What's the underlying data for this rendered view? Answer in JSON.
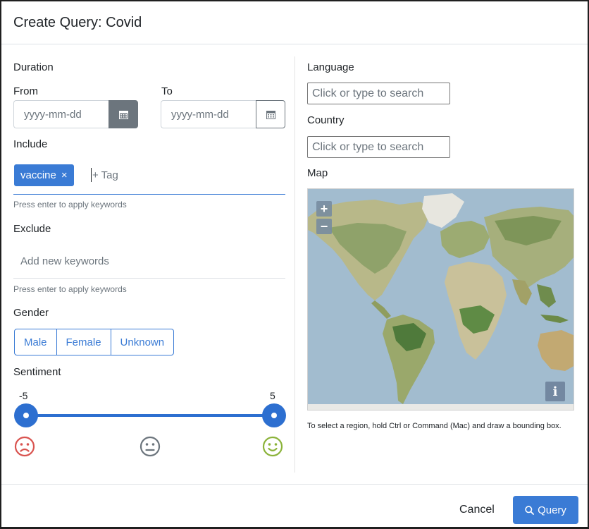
{
  "modal": {
    "title": "Create Query: Covid"
  },
  "duration": {
    "label": "Duration",
    "from_label": "From",
    "to_label": "To",
    "from_placeholder": "yyyy-mm-dd",
    "to_placeholder": "yyyy-mm-dd"
  },
  "include": {
    "label": "Include",
    "tags": [
      {
        "text": "vaccine",
        "remove": "×"
      }
    ],
    "tag_placeholder": "+ Tag",
    "help": "Press enter to apply keywords"
  },
  "exclude": {
    "label": "Exclude",
    "placeholder": "Add new keywords",
    "help": "Press enter to apply keywords"
  },
  "gender": {
    "label": "Gender",
    "options": [
      "Male",
      "Female",
      "Unknown"
    ]
  },
  "sentiment": {
    "label": "Sentiment",
    "min": "-5",
    "max": "5",
    "icons": [
      "sad-face-icon",
      "neutral-face-icon",
      "happy-face-icon"
    ],
    "colors": {
      "sad": "#d9534f",
      "neutral": "#6c757d",
      "happy": "#8bb33a"
    }
  },
  "language": {
    "label": "Language",
    "placeholder": "Click or type to search"
  },
  "country": {
    "label": "Country",
    "placeholder": "Click or type to search"
  },
  "map": {
    "label": "Map",
    "zoom_in": "+",
    "zoom_out": "−",
    "info": "i",
    "help": "To select a region, hold Ctrl or Command (Mac) and draw a bounding box."
  },
  "footer": {
    "cancel": "Cancel",
    "query": "Query"
  },
  "colors": {
    "primary": "#3a7bd5",
    "secondary": "#6c757d"
  }
}
